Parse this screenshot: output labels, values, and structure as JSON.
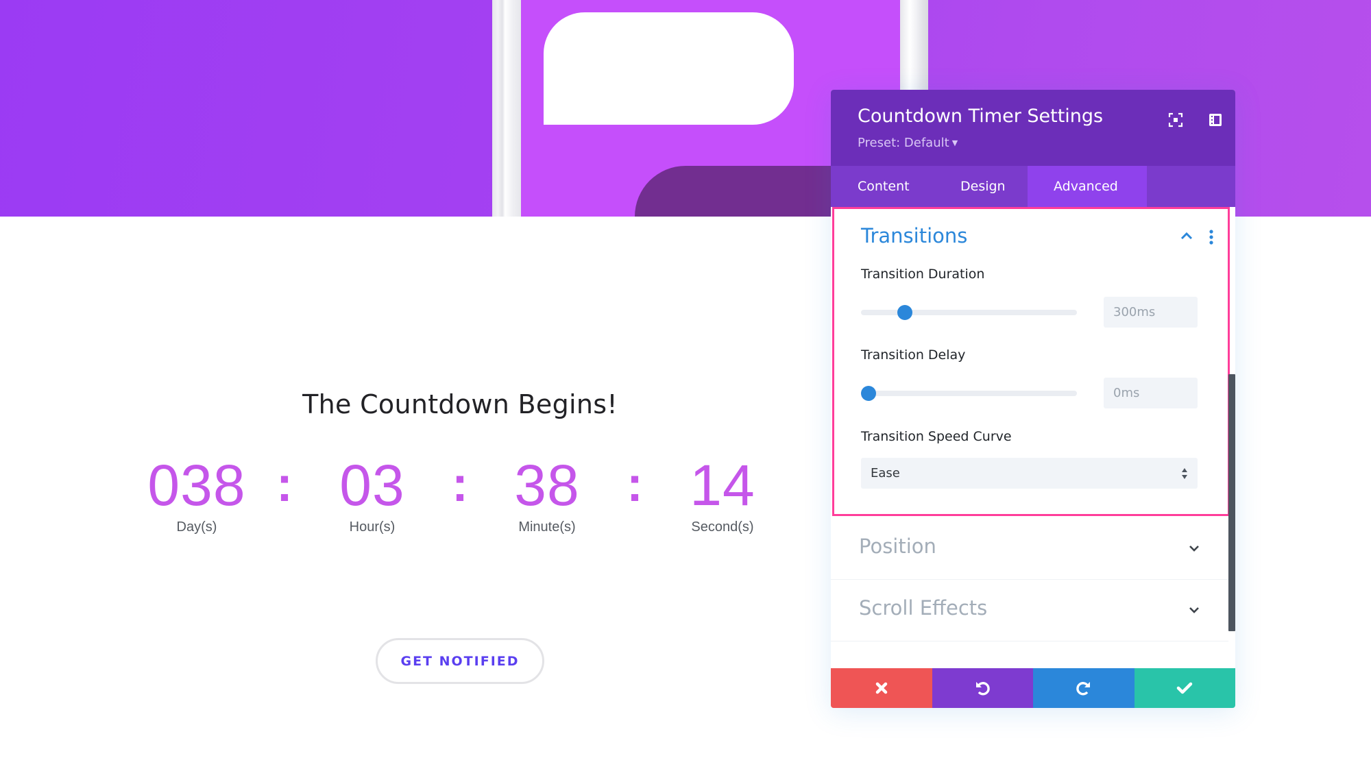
{
  "background": {
    "band_color": "#a441f2",
    "phone_screen_color": "#c54ffb",
    "pill_color": "#722e90"
  },
  "countdown": {
    "title": "The Countdown Begins!",
    "number_color": "#c556ea",
    "separator": ":",
    "units": [
      {
        "value": "038",
        "label": "Day(s)"
      },
      {
        "value": "03",
        "label": "Hour(s)"
      },
      {
        "value": "38",
        "label": "Minute(s)"
      },
      {
        "value": "14",
        "label": "Second(s)"
      }
    ],
    "cta_label": "GET NOTIFIED"
  },
  "panel": {
    "title": "Countdown Timer Settings",
    "preset_label": "Preset: Default",
    "header_icons": [
      "fullscreen-icon",
      "split-view-icon",
      "more-options-icon"
    ],
    "tabs": [
      {
        "label": "Content",
        "active": false
      },
      {
        "label": "Design",
        "active": false
      },
      {
        "label": "Advanced",
        "active": true
      }
    ],
    "open_section": {
      "title": "Transitions",
      "fields": {
        "duration": {
          "label": "Transition Duration",
          "value": "300ms",
          "slider_fraction": 0.18
        },
        "delay": {
          "label": "Transition Delay",
          "value": "0ms",
          "slider_fraction": 0.0
        },
        "curve": {
          "label": "Transition Speed Curve",
          "value": "Ease"
        }
      }
    },
    "closed_sections": [
      {
        "title": "Position"
      },
      {
        "title": "Scroll Effects"
      }
    ],
    "footer": {
      "discard": {
        "icon": "close-icon",
        "color": "#ef5555"
      },
      "undo": {
        "icon": "undo-icon",
        "color": "#7e3bd0"
      },
      "redo": {
        "icon": "redo-icon",
        "color": "#2b87da"
      },
      "save": {
        "icon": "check-icon",
        "color": "#29c4a9"
      }
    },
    "highlight_color": "#ff3d9a",
    "accent_color": "#2b87da"
  }
}
